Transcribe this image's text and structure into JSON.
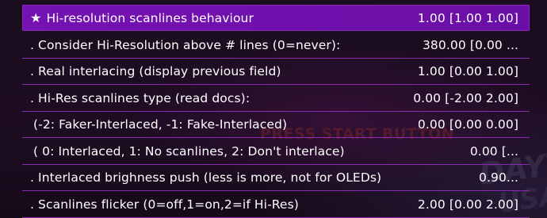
{
  "background": {
    "faded_text": "PRESS START BUTTON",
    "logo_line1": "DAYTON",
    "logo_line2": "USA"
  },
  "menu": {
    "items": [
      {
        "marker": "★",
        "label": "Hi-resolution scanlines behaviour",
        "value": "1.00 [1.00 1.00]",
        "selected": true
      },
      {
        "marker": "",
        "label": ". Consider Hi-Resolution above # lines (0=never):",
        "value": "380.00 [0.00 ...",
        "selected": false
      },
      {
        "marker": "",
        "label": ". Real interlacing (display previous field)",
        "value": "1.00 [0.00 1.00]",
        "selected": false
      },
      {
        "marker": "",
        "label": ". Hi-Res scanlines type (read docs):",
        "value": "0.00 [-2.00 2.00]",
        "selected": false
      },
      {
        "marker": "",
        "label": " (-2: Faker-Interlaced, -1: Fake-Interlaced)",
        "value": "0.00 [0.00 0.00]",
        "selected": false
      },
      {
        "marker": "",
        "label": " ( 0: Interlaced, 1: No scanlines, 2: Don't interlace)",
        "value": "0.00 [...",
        "selected": false
      },
      {
        "marker": "",
        "label": ". Interlaced brighness push (less is more, not for OLEDs)",
        "value": "0.90...",
        "selected": false
      },
      {
        "marker": "",
        "label": ". Scanlines flicker (0=off,1=on,2=if Hi-Res)",
        "value": "2.00 [0.00 2.00]",
        "selected": false
      }
    ]
  },
  "colors": {
    "selected_bg": "#7512b2",
    "divider": "#8a2ab0",
    "background": "#1b0d1f"
  }
}
